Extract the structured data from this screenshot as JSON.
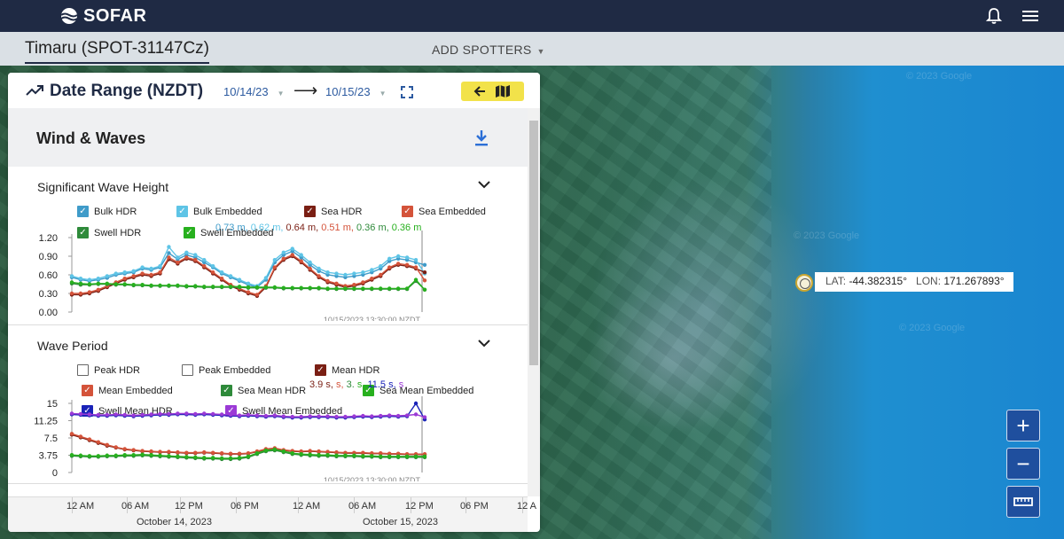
{
  "brand": "SOFAR",
  "spotter_name": "Timaru (SPOT-31147Cz)",
  "add_spotters": "ADD SPOTTERS",
  "date_range": {
    "title": "Date Range (NZDT)",
    "start": "10/14/23",
    "end": "10/15/23"
  },
  "section_title": "Wind & Waves",
  "coordinates": {
    "lat_label": "LAT:",
    "lat": "-44.382315°",
    "lon_label": "LON:",
    "lon": "171.267893°"
  },
  "map_watermark": "© 2023 Google",
  "zoom": {
    "in": "+",
    "out": "−"
  },
  "chart_data": [
    {
      "type": "line",
      "title": "Significant Wave Height",
      "y_ticks": [
        "1.20",
        "0.90",
        "0.60",
        "0.30",
        "0.00"
      ],
      "ylim": [
        0,
        1.2
      ],
      "timestamp": "10/15/2023 13:30:00 NZDT",
      "legend": [
        {
          "name": "Bulk HDR",
          "color": "#3f9bc9",
          "checked": true
        },
        {
          "name": "Bulk Embedded",
          "color": "#5ec4e6",
          "checked": true
        },
        {
          "name": "Sea HDR",
          "color": "#7a1f14",
          "checked": true
        },
        {
          "name": "Sea Embedded",
          "color": "#d4533a",
          "checked": true
        },
        {
          "name": "Swell HDR",
          "color": "#2e8a3a",
          "checked": true
        },
        {
          "name": "Swell Embedded",
          "color": "#27b01e",
          "checked": true
        }
      ],
      "readouts": [
        {
          "text": "0.73 m,",
          "color": "#3f9bc9"
        },
        {
          "text": "0.62 m,",
          "color": "#5ec4e6"
        },
        {
          "text": "0.64 m,",
          "color": "#7a1f14"
        },
        {
          "text": "0.51 m,",
          "color": "#d4533a"
        },
        {
          "text": "0.36 m,",
          "color": "#2e8a3a"
        },
        {
          "text": "0.36 m",
          "color": "#27b01e"
        }
      ],
      "series": [
        {
          "name": "Bulk HDR",
          "color": "#3f9bc9",
          "values": [
            0.56,
            0.52,
            0.5,
            0.52,
            0.55,
            0.6,
            0.62,
            0.64,
            0.7,
            0.68,
            0.72,
            0.95,
            0.85,
            0.92,
            0.88,
            0.8,
            0.72,
            0.62,
            0.56,
            0.5,
            0.44,
            0.4,
            0.52,
            0.8,
            0.92,
            0.98,
            0.88,
            0.76,
            0.66,
            0.6,
            0.58,
            0.56,
            0.58,
            0.6,
            0.64,
            0.7,
            0.82,
            0.86,
            0.84,
            0.8,
            0.76
          ]
        },
        {
          "name": "Bulk Embedded",
          "color": "#5ec4e6",
          "values": [
            0.58,
            0.54,
            0.52,
            0.54,
            0.58,
            0.62,
            0.64,
            0.66,
            0.72,
            0.7,
            0.74,
            1.05,
            0.88,
            0.96,
            0.92,
            0.84,
            0.74,
            0.64,
            0.58,
            0.52,
            0.46,
            0.42,
            0.55,
            0.84,
            0.96,
            1.02,
            0.92,
            0.8,
            0.7,
            0.64,
            0.62,
            0.6,
            0.62,
            0.64,
            0.68,
            0.74,
            0.86,
            0.9,
            0.88,
            0.84,
            0.62
          ]
        },
        {
          "name": "Sea HDR",
          "color": "#7a1f14",
          "values": [
            0.28,
            0.28,
            0.3,
            0.34,
            0.4,
            0.46,
            0.52,
            0.56,
            0.6,
            0.58,
            0.62,
            0.85,
            0.78,
            0.86,
            0.82,
            0.72,
            0.62,
            0.52,
            0.42,
            0.36,
            0.3,
            0.26,
            0.4,
            0.7,
            0.84,
            0.9,
            0.8,
            0.68,
            0.56,
            0.48,
            0.44,
            0.4,
            0.42,
            0.46,
            0.52,
            0.58,
            0.7,
            0.76,
            0.74,
            0.7,
            0.64
          ]
        },
        {
          "name": "Sea Embedded",
          "color": "#d4533a",
          "values": [
            0.3,
            0.3,
            0.32,
            0.36,
            0.42,
            0.48,
            0.54,
            0.58,
            0.62,
            0.6,
            0.64,
            0.88,
            0.8,
            0.88,
            0.84,
            0.74,
            0.64,
            0.54,
            0.44,
            0.38,
            0.32,
            0.28,
            0.42,
            0.72,
            0.86,
            0.92,
            0.82,
            0.7,
            0.58,
            0.5,
            0.46,
            0.42,
            0.44,
            0.48,
            0.54,
            0.6,
            0.72,
            0.78,
            0.76,
            0.72,
            0.51
          ]
        },
        {
          "name": "Swell HDR",
          "color": "#2e8a3a",
          "values": [
            0.46,
            0.44,
            0.44,
            0.45,
            0.45,
            0.44,
            0.44,
            0.43,
            0.43,
            0.42,
            0.42,
            0.42,
            0.42,
            0.41,
            0.41,
            0.4,
            0.4,
            0.4,
            0.4,
            0.4,
            0.39,
            0.39,
            0.39,
            0.39,
            0.38,
            0.38,
            0.38,
            0.38,
            0.38,
            0.37,
            0.37,
            0.37,
            0.37,
            0.37,
            0.37,
            0.37,
            0.37,
            0.37,
            0.37,
            0.5,
            0.36
          ]
        },
        {
          "name": "Swell Embedded",
          "color": "#27b01e",
          "values": [
            0.48,
            0.46,
            0.45,
            0.46,
            0.46,
            0.45,
            0.45,
            0.44,
            0.44,
            0.43,
            0.43,
            0.43,
            0.43,
            0.42,
            0.42,
            0.41,
            0.41,
            0.41,
            0.41,
            0.41,
            0.4,
            0.4,
            0.4,
            0.4,
            0.39,
            0.39,
            0.39,
            0.39,
            0.39,
            0.38,
            0.38,
            0.38,
            0.38,
            0.38,
            0.38,
            0.38,
            0.38,
            0.38,
            0.38,
            0.52,
            0.36
          ]
        }
      ]
    },
    {
      "type": "line",
      "title": "Wave Period",
      "y_ticks": [
        "15",
        "11.25",
        "7.5",
        "3.75",
        "0"
      ],
      "ylim": [
        0,
        15
      ],
      "timestamp": "10/15/2023 13:30:00 NZDT",
      "legend": [
        {
          "name": "Peak HDR",
          "color": "#666666",
          "checked": false
        },
        {
          "name": "Peak Embedded",
          "color": "#666666",
          "checked": false
        },
        {
          "name": "Mean HDR",
          "color": "#7a1f14",
          "checked": true
        },
        {
          "name": "Mean Embedded",
          "color": "#d4533a",
          "checked": true
        },
        {
          "name": "Sea Mean HDR",
          "color": "#2e8a3a",
          "checked": true
        },
        {
          "name": "Sea Mean Embedded",
          "color": "#27b01e",
          "checked": true
        },
        {
          "name": "Swell Mean HDR",
          "color": "#1a23b8",
          "checked": true
        },
        {
          "name": "Swell Mean Embedded",
          "color": "#9b3ad6",
          "checked": true
        }
      ],
      "readouts": [
        {
          "text": "3.9 s,",
          "color": "#7a1f14"
        },
        {
          "text": "s,",
          "color": "#d4533a"
        },
        {
          "text": "3.",
          "color": "#2e8a3a"
        },
        {
          "text": "s,",
          "color": "#27b01e"
        },
        {
          "text": "11.5 s,",
          "color": "#1a23b8"
        },
        {
          "text": "s",
          "color": "#9b3ad6"
        }
      ],
      "series": [
        {
          "name": "Mean HDR",
          "color": "#7a1f14",
          "values": [
            8.2,
            7.6,
            7.0,
            6.4,
            5.8,
            5.4,
            5.0,
            4.8,
            4.6,
            4.5,
            4.4,
            4.4,
            4.3,
            4.2,
            4.2,
            4.3,
            4.2,
            4.1,
            4.0,
            4.0,
            4.1,
            4.5,
            5.0,
            5.2,
            4.8,
            4.6,
            4.5,
            4.6,
            4.5,
            4.4,
            4.3,
            4.2,
            4.2,
            4.2,
            4.1,
            4.1,
            4.0,
            4.0,
            3.9,
            3.9,
            3.9
          ]
        },
        {
          "name": "Mean Embedded",
          "color": "#d4533a",
          "values": [
            8.4,
            7.8,
            7.2,
            6.6,
            6.0,
            5.5,
            5.1,
            4.9,
            4.7,
            4.6,
            4.5,
            4.5,
            4.4,
            4.3,
            4.3,
            4.4,
            4.3,
            4.2,
            4.1,
            4.1,
            4.2,
            4.6,
            5.1,
            5.3,
            4.9,
            4.7,
            4.6,
            4.7,
            4.6,
            4.5,
            4.4,
            4.3,
            4.3,
            4.3,
            4.2,
            4.2,
            4.1,
            4.1,
            4.0,
            4.0,
            4.0
          ]
        },
        {
          "name": "Sea Mean HDR",
          "color": "#2e8a3a",
          "values": [
            3.6,
            3.5,
            3.4,
            3.4,
            3.5,
            3.5,
            3.6,
            3.6,
            3.7,
            3.6,
            3.5,
            3.4,
            3.3,
            3.2,
            3.1,
            3.0,
            3.0,
            2.9,
            2.9,
            3.0,
            3.3,
            4.0,
            4.6,
            4.8,
            4.4,
            4.0,
            3.8,
            3.7,
            3.6,
            3.6,
            3.5,
            3.5,
            3.5,
            3.4,
            3.4,
            3.3,
            3.3,
            3.3,
            3.3,
            3.3,
            3.3
          ]
        },
        {
          "name": "Sea Mean Embedded",
          "color": "#27b01e",
          "values": [
            3.8,
            3.7,
            3.6,
            3.6,
            3.7,
            3.7,
            3.8,
            3.8,
            3.9,
            3.8,
            3.7,
            3.6,
            3.5,
            3.4,
            3.3,
            3.2,
            3.2,
            3.1,
            3.1,
            3.2,
            3.5,
            4.2,
            4.8,
            5.0,
            4.6,
            4.2,
            4.0,
            3.9,
            3.8,
            3.8,
            3.7,
            3.7,
            3.7,
            3.6,
            3.6,
            3.5,
            3.5,
            3.5,
            3.5,
            3.5,
            3.5
          ]
        },
        {
          "name": "Swell Mean HDR",
          "color": "#1a23b8",
          "values": [
            12.6,
            12.5,
            12.4,
            12.3,
            12.3,
            12.4,
            12.3,
            12.2,
            12.3,
            12.4,
            12.5,
            12.5,
            12.6,
            12.6,
            12.5,
            12.6,
            12.5,
            12.4,
            12.3,
            12.2,
            12.3,
            12.2,
            12.1,
            12.2,
            12.0,
            11.9,
            11.9,
            12.0,
            12.0,
            12.0,
            11.9,
            11.9,
            12.0,
            12.1,
            12.0,
            12.1,
            12.2,
            12.1,
            12.2,
            15.0,
            11.5
          ]
        },
        {
          "name": "Swell Mean Embedded",
          "color": "#9b3ad6",
          "values": [
            12.8,
            12.7,
            12.6,
            12.5,
            12.5,
            12.6,
            12.5,
            12.4,
            12.5,
            12.6,
            12.7,
            12.7,
            12.8,
            12.8,
            12.7,
            12.8,
            12.7,
            12.6,
            12.5,
            12.4,
            12.5,
            12.4,
            12.3,
            12.4,
            12.2,
            12.1,
            12.1,
            12.2,
            12.2,
            12.2,
            12.1,
            12.1,
            12.2,
            12.3,
            12.2,
            12.3,
            12.4,
            12.3,
            12.4,
            12.6,
            12.0
          ]
        }
      ]
    }
  ],
  "x_axis": {
    "ticks": [
      "12 AM",
      "06 AM",
      "12 PM",
      "06 PM",
      "12 AM",
      "06 AM",
      "12 PM",
      "06 PM",
      "12 A"
    ],
    "dates": [
      "October 14, 2023",
      "October 15, 2023"
    ]
  }
}
